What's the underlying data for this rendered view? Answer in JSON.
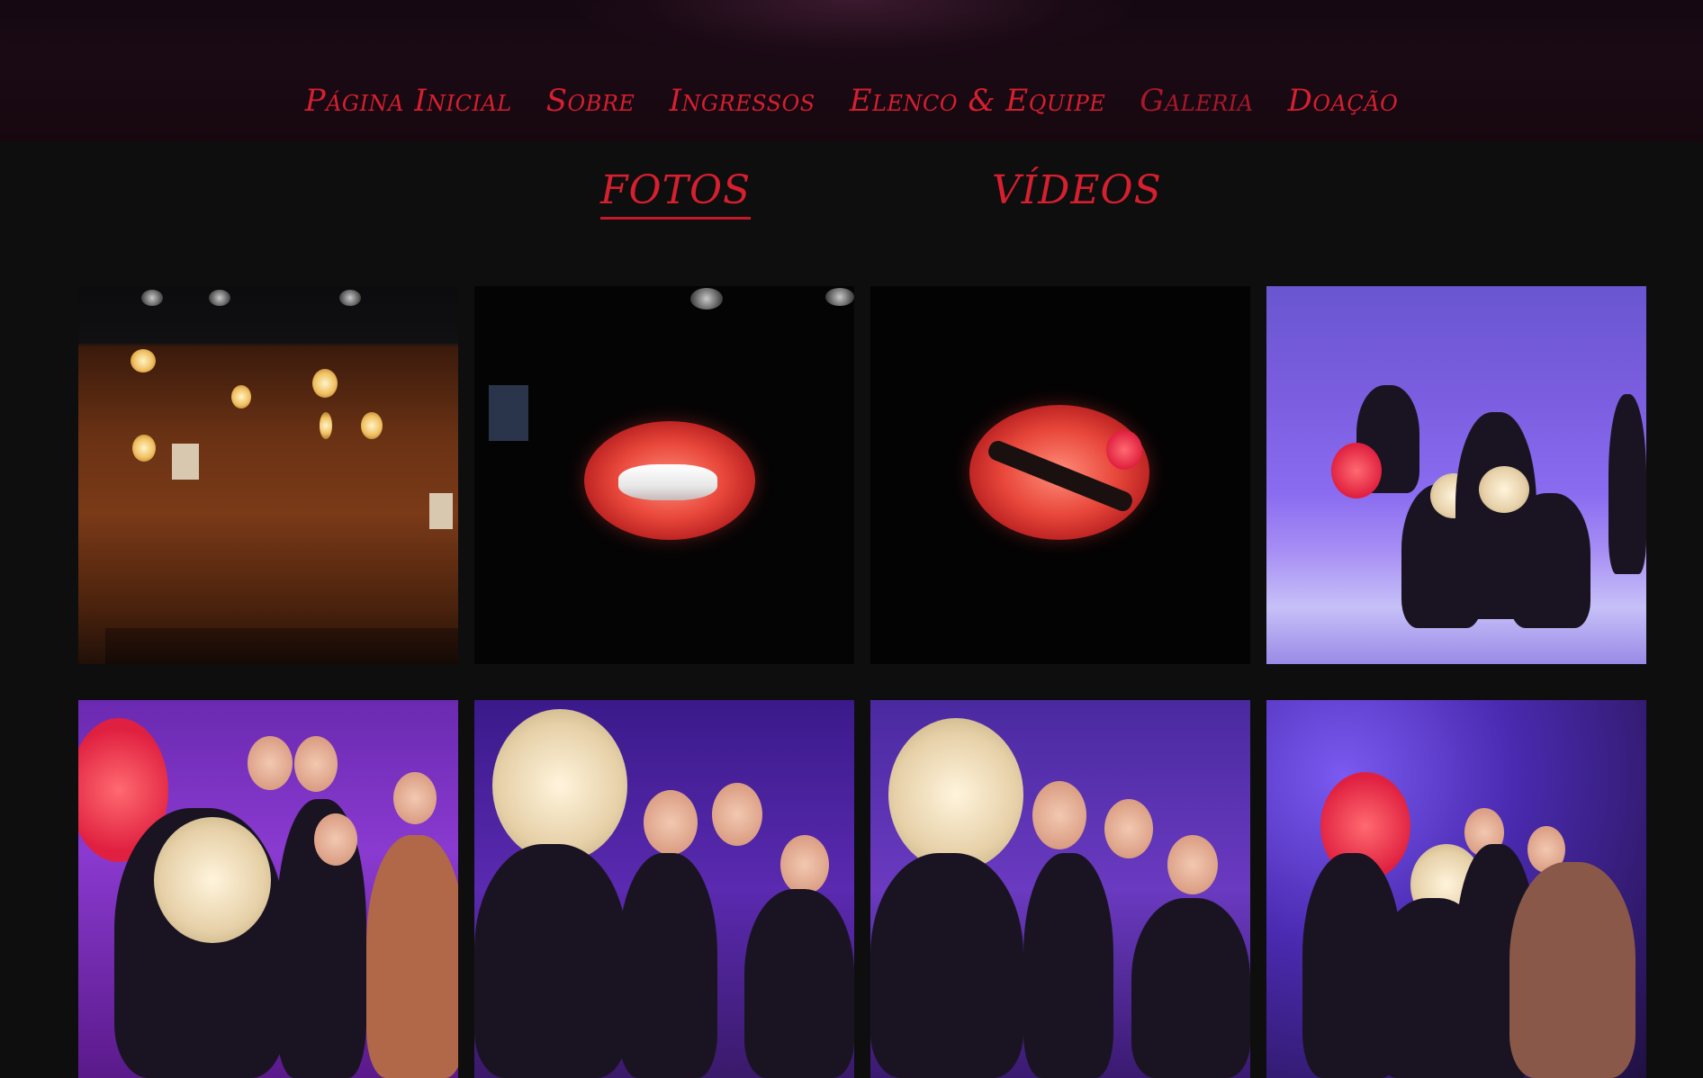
{
  "nav": {
    "items": [
      {
        "label": "Página Inicial"
      },
      {
        "label": "Sobre"
      },
      {
        "label": "Ingressos"
      },
      {
        "label": "Elenco & Equipe"
      },
      {
        "label": "Galeria"
      },
      {
        "label": "Doação"
      }
    ],
    "active": "Galeria"
  },
  "tabs": {
    "fotos": "FOTOS",
    "videos": "VÍDEOS",
    "active": "FOTOS"
  },
  "gallery": {
    "photos": [
      {
        "subject": "brick-wall-stage"
      },
      {
        "subject": "red-lips-projection"
      },
      {
        "subject": "red-lips-with-dancer"
      },
      {
        "subject": "cast-group-purple-stage"
      },
      {
        "subject": "cast-group-close-up"
      },
      {
        "subject": "cast-group-smiling"
      },
      {
        "subject": "cast-group-kiss"
      },
      {
        "subject": "cast-group-purple-haze"
      }
    ]
  },
  "colors": {
    "accent": "#d61f2f",
    "background": "#0e0e0e",
    "header": "#1a0a14"
  }
}
